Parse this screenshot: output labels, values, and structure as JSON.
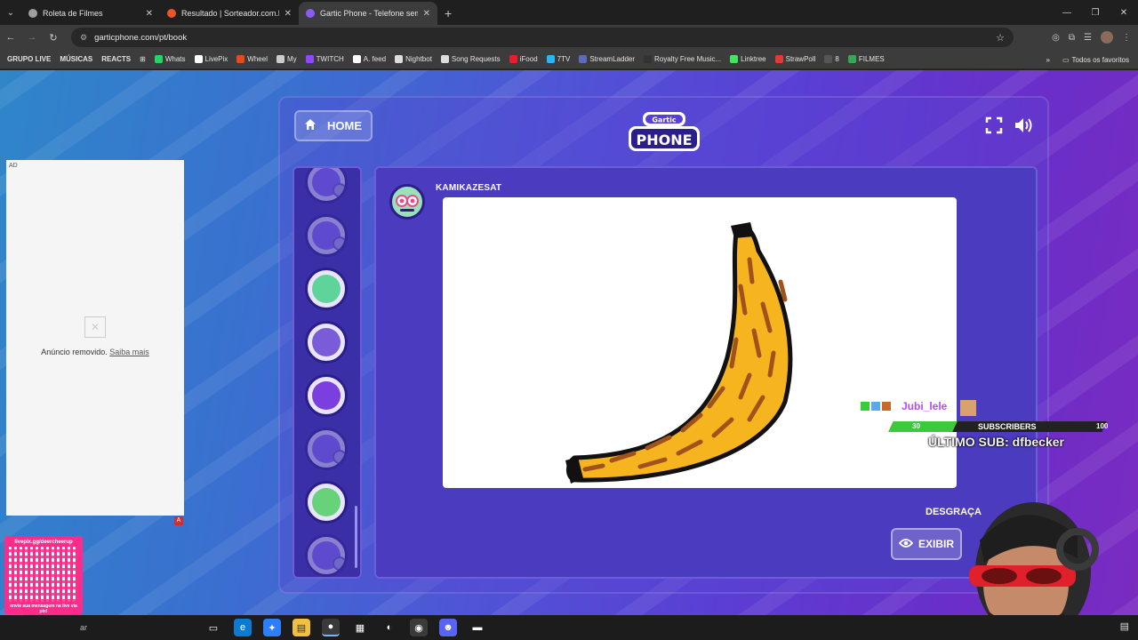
{
  "browser": {
    "tabs": [
      {
        "title": "Roleta de Filmes",
        "color": "#9e9e9e",
        "active": false
      },
      {
        "title": "Resultado | Sorteador.com.br -",
        "color": "#e8562a",
        "active": false
      },
      {
        "title": "Gartic Phone - Telefone sem fio",
        "color": "#8b5cf6",
        "active": true
      }
    ],
    "url": "garticphone.com/pt/book",
    "bookmarks": [
      {
        "label": "GRUPO LIVE",
        "bold": true,
        "color": ""
      },
      {
        "label": "MÚSICAS",
        "bold": true,
        "color": ""
      },
      {
        "label": "REACTS",
        "bold": true,
        "color": ""
      },
      {
        "label": "Whats",
        "bold": false,
        "color": "#25d366"
      },
      {
        "label": "LivePix",
        "bold": false,
        "color": "#ffffff"
      },
      {
        "label": "Wheel",
        "bold": false,
        "color": "#e64a19"
      },
      {
        "label": "My",
        "bold": false,
        "color": "#cccccc"
      },
      {
        "label": "TWITCH",
        "bold": false,
        "color": "#9146ff"
      },
      {
        "label": "A. feed",
        "bold": false,
        "color": "#ffffff"
      },
      {
        "label": "Nightbot",
        "bold": false,
        "color": "#dddddd"
      },
      {
        "label": "Song Requests",
        "bold": false,
        "color": "#dddddd"
      },
      {
        "label": "iFood",
        "bold": false,
        "color": "#ea1d2c"
      },
      {
        "label": "7TV",
        "bold": false,
        "color": "#29b6f6"
      },
      {
        "label": "StreamLadder",
        "bold": false,
        "color": "#5c6bc0"
      },
      {
        "label": "Royalty Free Music...",
        "bold": false,
        "color": "#333333"
      },
      {
        "label": "Linktree",
        "bold": false,
        "color": "#43e55e"
      },
      {
        "label": "StrawPoll",
        "bold": false,
        "color": "#e53935"
      },
      {
        "label": "8",
        "bold": false,
        "color": "#555555"
      },
      {
        "label": "FILMES",
        "bold": false,
        "color": "#34a853"
      }
    ],
    "favorites_label": "Todos os favoritos"
  },
  "ad": {
    "tag": "AD",
    "removed_text": "Anúncio removido.",
    "learn_more": "Saiba mais",
    "badge": "A"
  },
  "qr": {
    "top": "livepix.gg/deercheerup",
    "bottom": "envie sua mensagem na live via pix!"
  },
  "game": {
    "home_label": "HOME",
    "author": "KAMIKAZESAT",
    "section_label": "DESGRAÇA",
    "show_label": "EXIBIR",
    "players": [
      {
        "dim": true,
        "color": "#8a6cff"
      },
      {
        "dim": true,
        "color": "#8a6cff"
      },
      {
        "dim": false,
        "color": "#5fd49a"
      },
      {
        "dim": false,
        "color": "#7a5bd8"
      },
      {
        "dim": false,
        "color": "#7b3fe0"
      },
      {
        "dim": true,
        "color": "#8a6cff"
      },
      {
        "dim": false,
        "color": "#67d27a"
      },
      {
        "dim": true,
        "color": "#8a6cff"
      }
    ]
  },
  "stream_overlay": {
    "username": "Jubi_lele",
    "current": "30",
    "label": "SUBSCRIBERS",
    "goal": "100",
    "progress": 0.3,
    "last_sub": "ÚLTIMO SUB: dfbecker"
  },
  "taskbar": {
    "search": "ar"
  }
}
